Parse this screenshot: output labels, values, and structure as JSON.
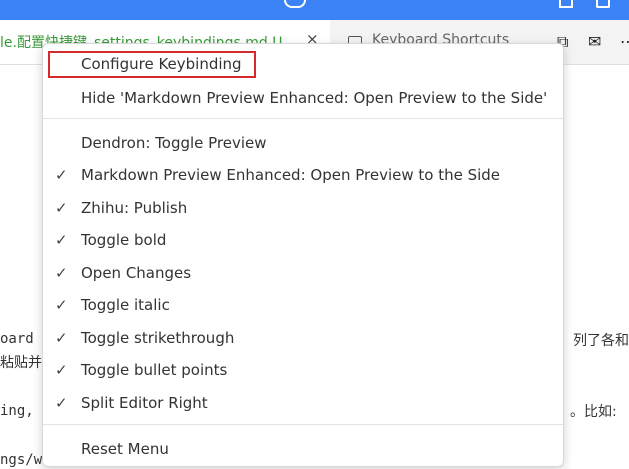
{
  "tabs": [
    {
      "label": "le.配置快捷键_settings_keybindings.md U",
      "close": "×",
      "status_color": "#3a9b3a"
    },
    {
      "label": "Keyboard Shortcuts"
    }
  ],
  "actions": [
    {
      "icon": "open-preview-icon",
      "glyph": "⧉"
    },
    {
      "icon": "mail-icon",
      "glyph": "✉"
    },
    {
      "icon": "more-icon",
      "glyph": "⋯"
    }
  ],
  "editor": {
    "line1_left": "oard",
    "line1_right": "列了各和",
    "line2_left": "粘贴并",
    "line3_left": "ing,",
    "line3_right": "。比如:",
    "line4_left": "ngs/w"
  },
  "menu": {
    "top_items": [
      {
        "label": "Configure Keybinding",
        "highlighted": true
      },
      {
        "label": "Hide 'Markdown Preview Enhanced: Open Preview to the Side'"
      }
    ],
    "toggle_items": [
      {
        "label": "Dendron: Toggle Preview",
        "checked": false
      },
      {
        "label": "Markdown Preview Enhanced: Open Preview to the Side",
        "checked": true
      },
      {
        "label": "Zhihu: Publish",
        "checked": true
      },
      {
        "label": "Toggle bold",
        "checked": true
      },
      {
        "label": "Open Changes",
        "checked": true
      },
      {
        "label": "Toggle italic",
        "checked": true
      },
      {
        "label": "Toggle strikethrough",
        "checked": true
      },
      {
        "label": "Toggle bullet points",
        "checked": true
      },
      {
        "label": "Split Editor Right",
        "checked": true
      }
    ],
    "check_glyph": "✓",
    "reset_label": "Reset Menu",
    "highlight_color": "#d42a2a"
  }
}
